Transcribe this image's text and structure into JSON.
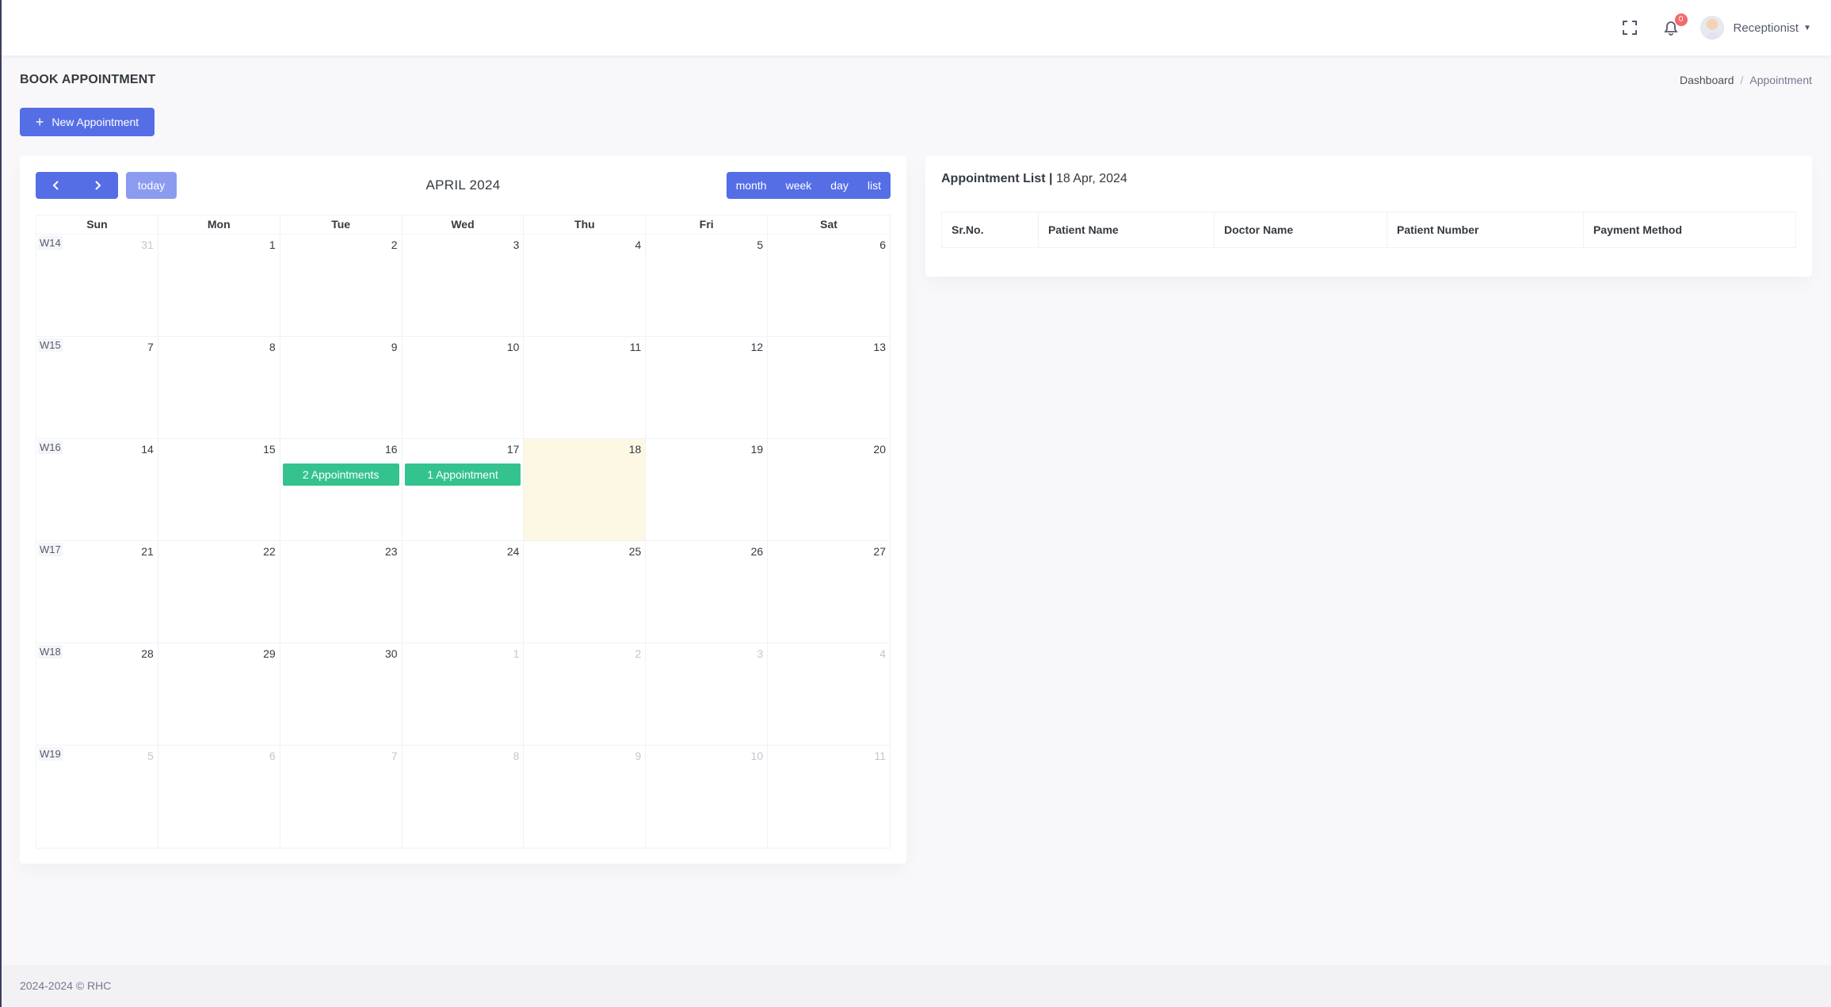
{
  "header": {
    "notification_count": "0",
    "user_name": "Receptionist"
  },
  "page": {
    "title": "BOOK APPOINTMENT",
    "breadcrumb": [
      "Dashboard",
      "Appointment"
    ],
    "new_button_label": "New Appointment"
  },
  "calendar": {
    "title": "APRIL 2024",
    "today_label": "today",
    "views": [
      "month",
      "week",
      "day",
      "list"
    ],
    "weekdays": [
      "Sun",
      "Mon",
      "Tue",
      "Wed",
      "Thu",
      "Fri",
      "Sat"
    ],
    "weeks": [
      {
        "label": "W14",
        "days": [
          "31",
          "1",
          "2",
          "3",
          "4",
          "5",
          "6"
        ]
      },
      {
        "label": "W15",
        "days": [
          "7",
          "8",
          "9",
          "10",
          "11",
          "12",
          "13"
        ]
      },
      {
        "label": "W16",
        "days": [
          "14",
          "15",
          "16",
          "17",
          "18",
          "19",
          "20"
        ]
      },
      {
        "label": "W17",
        "days": [
          "21",
          "22",
          "23",
          "24",
          "25",
          "26",
          "27"
        ]
      },
      {
        "label": "W18",
        "days": [
          "28",
          "29",
          "30",
          "1",
          "2",
          "3",
          "4"
        ]
      },
      {
        "label": "W19",
        "days": [
          "5",
          "6",
          "7",
          "8",
          "9",
          "10",
          "11"
        ]
      }
    ],
    "events": [
      {
        "label": "2 Appointments"
      },
      {
        "label": "1 Appointment"
      }
    ],
    "colors": {
      "primary": "#556ee6",
      "event": "#34c38f",
      "today": "#fcf8e3"
    }
  },
  "appointment_list": {
    "title": "Appointment List",
    "date": "18 Apr, 2024",
    "separator": "|",
    "columns": [
      "Sr.No.",
      "Patient Name",
      "Doctor Name",
      "Patient Number",
      "Payment Method"
    ]
  },
  "footer": {
    "text": "2024-2024 © RHC"
  }
}
